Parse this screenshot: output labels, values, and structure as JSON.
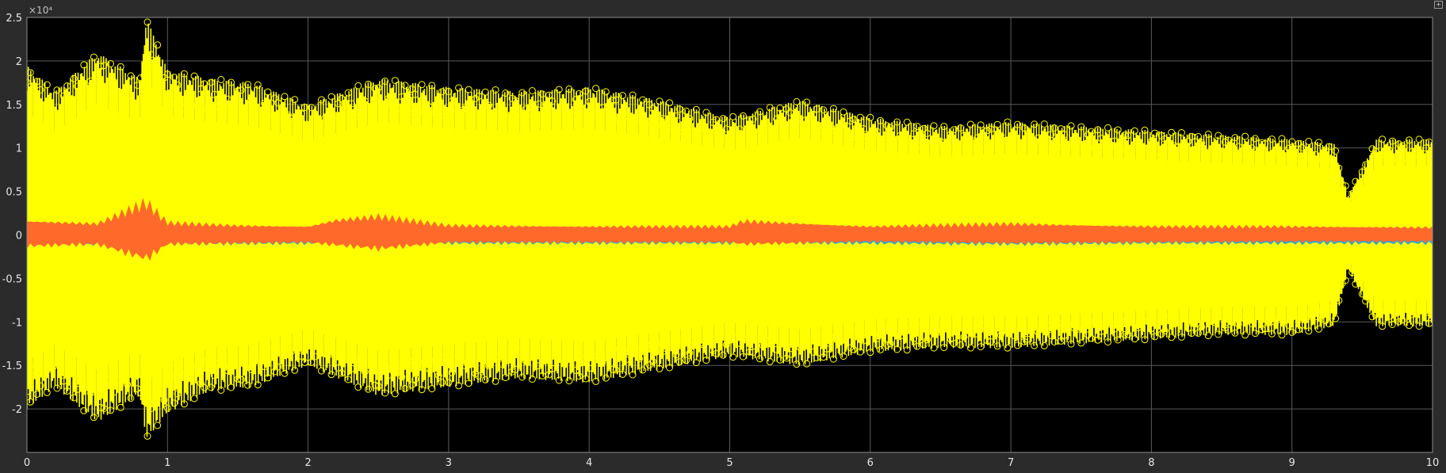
{
  "figure": {
    "maximize_icon": "expand-window-icon"
  },
  "chart_data": {
    "type": "line",
    "title": "",
    "xlabel": "",
    "ylabel": "",
    "xlim": [
      0,
      10
    ],
    "ylim": [
      -25000,
      25000
    ],
    "y_exponent_label": "×10⁴",
    "grid": true,
    "background": "#000000",
    "x_ticks": [
      {
        "value": 0,
        "label": "0"
      },
      {
        "value": 1,
        "label": "1"
      },
      {
        "value": 2,
        "label": "2"
      },
      {
        "value": 3,
        "label": "3"
      },
      {
        "value": 4,
        "label": "4"
      },
      {
        "value": 5,
        "label": "5"
      },
      {
        "value": 6,
        "label": "6"
      },
      {
        "value": 7,
        "label": "7"
      },
      {
        "value": 8,
        "label": "8"
      },
      {
        "value": 9,
        "label": "9"
      },
      {
        "value": 10,
        "label": "10"
      }
    ],
    "y_ticks": [
      {
        "value": 25000,
        "label": "2.5"
      },
      {
        "value": 20000,
        "label": "2"
      },
      {
        "value": 15000,
        "label": "1.5"
      },
      {
        "value": 10000,
        "label": "1"
      },
      {
        "value": 5000,
        "label": "0.5"
      },
      {
        "value": 0,
        "label": "0"
      },
      {
        "value": -5000,
        "label": "-0.5"
      },
      {
        "value": -10000,
        "label": "-1"
      },
      {
        "value": -15000,
        "label": "-1.5"
      },
      {
        "value": -20000,
        "label": "-2"
      }
    ],
    "series": [
      {
        "color": "#ffff00",
        "style": "stem with circle markers",
        "x": [
          0,
          0.2,
          0.5,
          0.8,
          0.85,
          1.0,
          1.3,
          1.6,
          2.0,
          2.5,
          3.0,
          3.5,
          4.0,
          4.5,
          5.0,
          5.5,
          6.0,
          6.5,
          7.0,
          7.5,
          8.0,
          8.5,
          9.0,
          9.3,
          9.4,
          9.6,
          10.0
        ],
        "upper": [
          19500,
          16500,
          21000,
          18000,
          25000,
          19000,
          18000,
          17500,
          15000,
          18000,
          17000,
          16500,
          17000,
          15500,
          13500,
          15500,
          13500,
          12500,
          13000,
          12500,
          12000,
          11500,
          11000,
          10500,
          4500,
          11000,
          11000
        ],
        "lower": [
          -20000,
          -17500,
          -21500,
          -18500,
          -23500,
          -20500,
          -18000,
          -17500,
          -15000,
          -18500,
          -17500,
          -16500,
          -17000,
          -15500,
          -14000,
          -15000,
          -13500,
          -13000,
          -13000,
          -12500,
          -12000,
          -11500,
          -11500,
          -10500,
          -4000,
          -10500,
          -10500
        ]
      },
      {
        "color": "#ff6a2a",
        "style": "line",
        "x": [
          0,
          0.5,
          0.85,
          1.0,
          1.5,
          2.0,
          2.2,
          2.5,
          3.0,
          4.0,
          5.0,
          5.1,
          6.0,
          7.0,
          8.0,
          9.0,
          10.0
        ],
        "upper": [
          1500,
          1200,
          3500,
          1300,
          1000,
          900,
          1600,
          2000,
          1000,
          900,
          900,
          1500,
          900,
          1200,
          900,
          900,
          800
        ],
        "lower": [
          -1200,
          -1000,
          -2600,
          -1000,
          -900,
          -800,
          -1100,
          -1500,
          -800,
          -800,
          -800,
          -1000,
          -700,
          -900,
          -800,
          -700,
          -700
        ]
      },
      {
        "color": "#2aa6dc",
        "style": "line",
        "x": [
          0,
          1,
          2,
          3,
          4,
          5,
          6,
          7,
          8,
          9,
          10
        ],
        "upper": [
          400,
          300,
          300,
          300,
          300,
          300,
          300,
          300,
          300,
          300,
          300
        ],
        "lower": [
          -1100,
          -1000,
          -900,
          -900,
          -900,
          -900,
          -900,
          -1000,
          -900,
          -900,
          -900
        ]
      }
    ]
  }
}
